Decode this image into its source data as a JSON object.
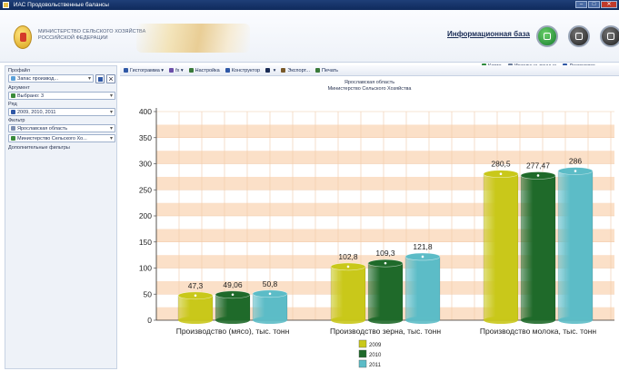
{
  "window": {
    "title": "ИАС Продовольственные балансы"
  },
  "banner": {
    "ministry_line1": "МИНИСТЕРСТВО СЕЛЬСКОГО ХОЗЯЙСТВА",
    "ministry_line2": "РОССИЙСКОЙ ФЕДЕРАЦИИ",
    "infobase_label": "Информационная база",
    "nav": [
      {
        "label": "Карта",
        "icon": "globe-icon",
        "color": "#2f8a3c"
      },
      {
        "label": "Исходные данные",
        "icon": "table-icon",
        "color": "#6b7c9a"
      },
      {
        "label": "Диаграмма",
        "icon": "chart-icon",
        "color": "#2f58a6"
      }
    ]
  },
  "left_panel": {
    "profile_label": "Профайл",
    "profile_value": "Запас производ...",
    "argument_label": "Аргумент",
    "argument_value": "Выбрано: 3",
    "row_label": "Ряд",
    "row_value": "2009, 2010, 2011",
    "filter_label": "Фильтр",
    "filter_value_1": "Ярославская область",
    "filter_value_2": "Министерство Сельского Хо...",
    "extra_filters_label": "Дополнительные фильтры"
  },
  "toolbar": {
    "items": [
      {
        "label": "Гистограмма",
        "icon": "histogram-icon",
        "color": "#2f58a6",
        "has_dropdown": true
      },
      {
        "label": "fx",
        "icon": "formula-icon",
        "color": "#6b4fa8",
        "has_dropdown": true
      },
      {
        "label": "Настройка",
        "icon": "settings-icon",
        "color": "#3a7a3a",
        "has_dropdown": false
      },
      {
        "label": "Конструктор",
        "icon": "constructor-icon",
        "color": "#2f58a6",
        "has_dropdown": false
      },
      {
        "label": "",
        "icon": "sort-icon",
        "color": "#1a2c55",
        "has_dropdown": true
      },
      {
        "label": "Экспорт...",
        "icon": "export-icon",
        "color": "#7a5a2a",
        "has_dropdown": false
      },
      {
        "label": "Печать",
        "icon": "print-icon",
        "color": "#3a7a3a",
        "has_dropdown": false
      }
    ]
  },
  "chart_header": {
    "line1": "Ярославская область",
    "line2": "Министерство Сельского Хозяйства"
  },
  "chart_data": {
    "type": "bar",
    "style": "3d-cylinder",
    "categories": [
      "Производство (мясо), тыс. тонн",
      "Производство зерна, тыс. тонн",
      "Производство молока, тыс. тонн"
    ],
    "series": [
      {
        "name": "2009",
        "values": [
          47.3,
          102.8,
          280.5
        ],
        "color": "#c9c81a"
      },
      {
        "name": "2010",
        "values": [
          49.06,
          109.3,
          277.47
        ],
        "color": "#1f6a2a"
      },
      {
        "name": "2011",
        "values": [
          50.8,
          121.8,
          286
        ],
        "color": "#5cbcc7"
      }
    ],
    "value_labels": [
      [
        "47,3",
        "102,8",
        "280,5"
      ],
      [
        "49,06",
        "109,3",
        "277,47"
      ],
      [
        "50,8",
        "121,8",
        "286"
      ]
    ],
    "ylim": [
      0,
      400
    ],
    "yticks": [
      0,
      50,
      100,
      150,
      200,
      250,
      300,
      350,
      400
    ],
    "grid": true,
    "background_bands": [
      "#fbe0c8",
      "#ffffff"
    ],
    "legend_position": "bottom"
  }
}
